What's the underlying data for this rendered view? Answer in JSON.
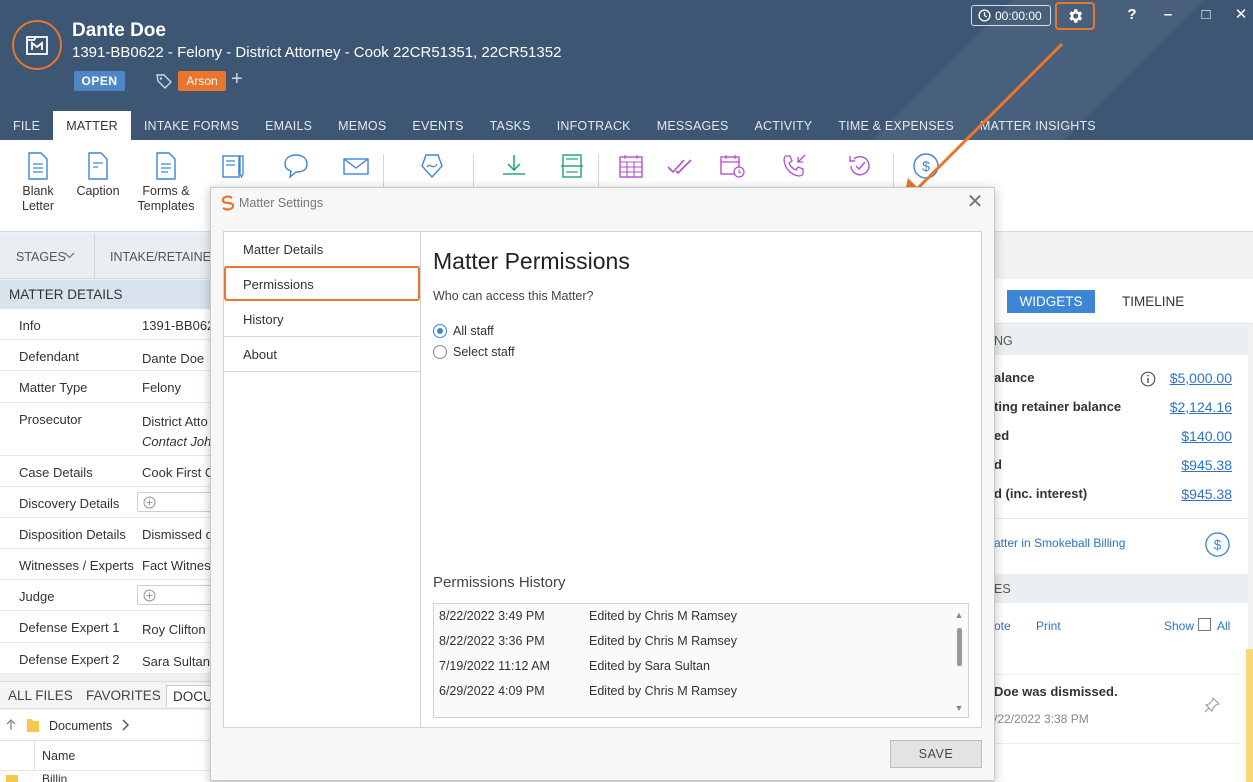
{
  "header": {
    "client_name": "Dante Doe",
    "matter_line": "1391-BB0622 - Felony - District Attorney - Cook 22CR51351, 22CR51352",
    "status": "OPEN",
    "tag": "Arson",
    "add_tag": "+",
    "timer": "00:00:00",
    "help": "?",
    "minimize": "–",
    "maximize": "□",
    "close": "✕"
  },
  "tabs": [
    "FILE",
    "MATTER",
    "INTAKE FORMS",
    "EMAILS",
    "MEMOS",
    "EVENTS",
    "TASKS",
    "INFOTRACK",
    "MESSAGES",
    "ACTIVITY",
    "TIME & EXPENSES",
    "MATTER INSIGHTS"
  ],
  "ribbon": {
    "blank_letter_1": "Blank",
    "blank_letter_2": "Letter",
    "caption": "Caption",
    "forms_1": "Forms &",
    "forms_2": "Templates"
  },
  "left": {
    "stages": "STAGES",
    "intake": "INTAKE/RETAINER",
    "matter_details": "MATTER DETAILS",
    "rows": [
      {
        "k": "Info",
        "v": "1391-BB0622"
      },
      {
        "k": "Defendant",
        "v": "Dante Doe"
      },
      {
        "k": "Matter Type",
        "v": "Felony"
      },
      {
        "k": "Prosecutor",
        "v": "District Atto",
        "v2": "Contact John"
      },
      {
        "k": "Case Details",
        "v": "Cook First C"
      },
      {
        "k": "Discovery Details",
        "v": ""
      },
      {
        "k": "Disposition Details",
        "v": "Dismissed o"
      },
      {
        "k": "Witnesses / Experts",
        "v": "Fact Witness"
      },
      {
        "k": "Judge",
        "v": ""
      },
      {
        "k": "Defense Expert 1",
        "v": "Roy Clifton"
      },
      {
        "k": "Defense Expert 2",
        "v": "Sara Sultan"
      }
    ],
    "all_files": "ALL FILES",
    "favorites": "FAVORITES",
    "documents_tab": "DOCU",
    "crumb": "Documents",
    "name_col": "Name",
    "bottom_item": "Billin"
  },
  "right": {
    "widgets": "WIDGETS",
    "timeline": "TIMELINE",
    "billing_head": "NG",
    "rows": [
      {
        "label": "alance",
        "amount": "$5,000.00"
      },
      {
        "label": "ting retainer balance",
        "amount": "$2,124.16"
      },
      {
        "label": "ed",
        "amount": "$140.00"
      },
      {
        "label": "d",
        "amount": "$945.38"
      },
      {
        "label": "d (inc. interest)",
        "amount": "$945.38"
      }
    ],
    "sb_link": "atter in Smokeball Billing",
    "memo_head": "ES",
    "memo_note": "ote",
    "memo_print": "Print",
    "memo_show": "Show",
    "memo_all": "All",
    "memo_text": "Doe was dismissed.",
    "memo_date": "/22/2022 3:38 PM"
  },
  "modal": {
    "title": "Matter Settings",
    "close": "✕",
    "nav": [
      "Matter Details",
      "Permissions",
      "History",
      "About"
    ],
    "heading": "Matter Permissions",
    "question": "Who can access this Matter?",
    "option_all": "All staff",
    "option_select": "Select staff",
    "history_title": "Permissions History",
    "history": [
      {
        "date": "8/22/2022 3:49 PM",
        "event": "Edited by Chris M Ramsey"
      },
      {
        "date": "8/22/2022 3:36 PM",
        "event": "Edited by Chris M Ramsey"
      },
      {
        "date": "7/19/2022 11:12 AM",
        "event": "Edited by Sara Sultan"
      },
      {
        "date": "6/29/2022 4:09 PM",
        "event": "Edited by Chris M Ramsey"
      }
    ],
    "save": "SAVE"
  },
  "colors": {
    "header_bg": "#3d5673",
    "accent_orange": "#e8762d",
    "accent_blue": "#3d86d6",
    "link_blue": "#2b74c7"
  }
}
